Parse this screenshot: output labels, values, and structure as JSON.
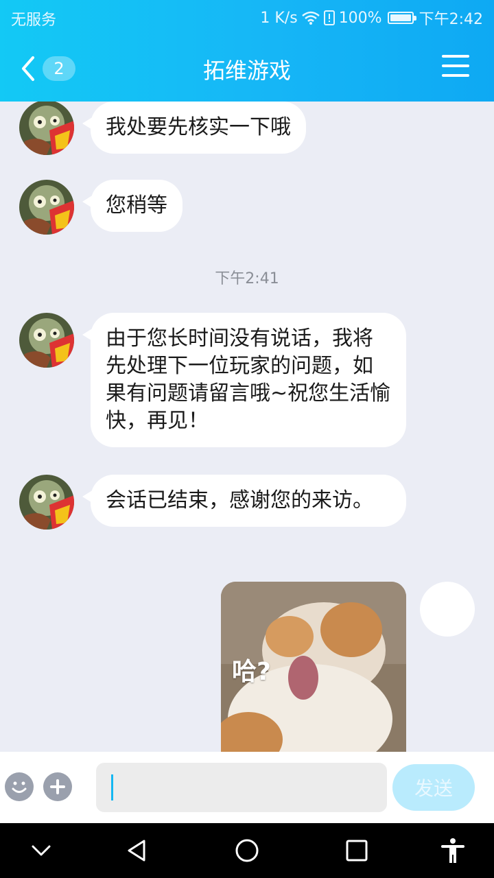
{
  "status_bar": {
    "carrier": "无服务",
    "speed": "1 K/s",
    "battery": "100%",
    "time": "下午2:42"
  },
  "header": {
    "back_count": "2",
    "title": "拓维游戏"
  },
  "messages": [
    {
      "text": "我处要先核实一下哦"
    },
    {
      "text": "您稍等"
    },
    {
      "timestamp": "下午2:41"
    },
    {
      "text": "由于您长时间没有说话，我将先处理下一位玩家的问题，如果有问题请留言哦~祝您生活愉快，再见！"
    },
    {
      "text": "会话已结束，感谢您的来访。"
    },
    {
      "image_caption": "哈?"
    }
  ],
  "input_bar": {
    "placeholder": "",
    "send_label": "发送"
  },
  "colors": {
    "header_blue": "#13c9f5",
    "chat_bg": "#ebedf5",
    "send_button": "#b9ebfd",
    "caret": "#14b7f2"
  },
  "icons": [
    "back-chevron-icon",
    "menu-icon",
    "emoji-icon",
    "plus-icon",
    "wifi-icon",
    "battery-icon",
    "nav-down-icon",
    "nav-back-icon",
    "nav-home-icon",
    "nav-recents-icon",
    "accessibility-icon"
  ]
}
